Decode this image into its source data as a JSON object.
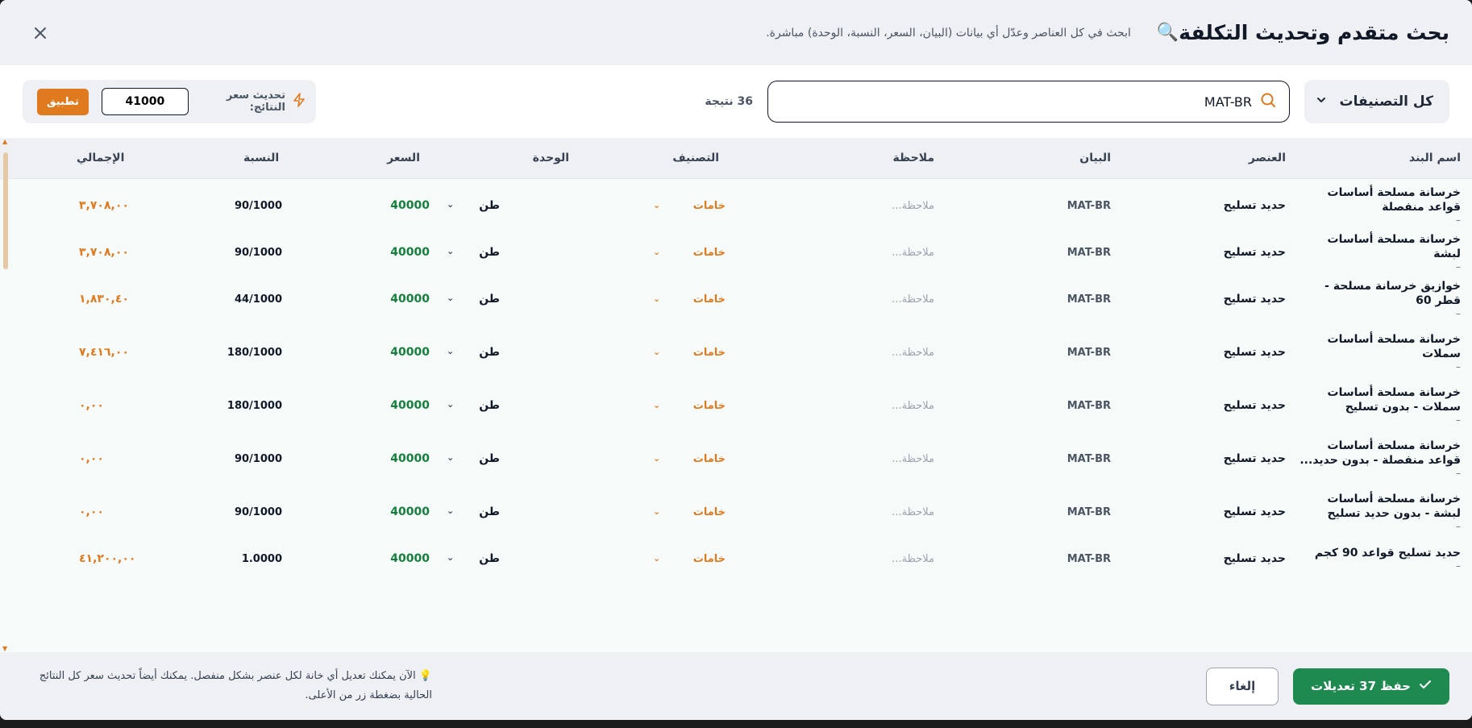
{
  "header": {
    "title": "بحث متقدم وتحديث التكلفة",
    "title_icon": "🔍",
    "subtitle": "ابحث في كل العناصر وعدّل أي بيانات (البيان، السعر، النسبة، الوحدة) مباشرة."
  },
  "toolbar": {
    "category_filter": "كل التصنيفات",
    "search_value": "MAT-BR",
    "result_count": "36 نتيجة",
    "bulk_label": "تحديث سعر النتائج:",
    "bulk_value": "41000",
    "apply_label": "تطبيق"
  },
  "columns": {
    "name": "اسم البند",
    "element": "العنصر",
    "description": "البيان",
    "note": "ملاحظة",
    "category": "التصنيف",
    "unit": "الوحدة",
    "price": "السعر",
    "ratio": "النسبة",
    "total": "الإجمالي"
  },
  "rows": [
    {
      "name": "خرسانة مسلحة أساسات قواعد منفصلة",
      "sub": "–",
      "element": "حديد تسليح",
      "description": "MAT-BR",
      "note": "ملاحظة...",
      "category": "خامات",
      "unit": "طن",
      "price": "40000",
      "ratio": "90/1000",
      "total": "٣,٧٠٨,٠٠"
    },
    {
      "name": "خرسانة مسلحة أساسات لبشة",
      "sub": "–",
      "element": "حديد تسليح",
      "description": "MAT-BR",
      "note": "ملاحظة...",
      "category": "خامات",
      "unit": "طن",
      "price": "40000",
      "ratio": "90/1000",
      "total": "٣,٧٠٨,٠٠"
    },
    {
      "name": "خوازيق خرسانة مسلحة - قطر 60",
      "sub": "–",
      "element": "حديد تسليح",
      "description": "MAT-BR",
      "note": "ملاحظة...",
      "category": "خامات",
      "unit": "طن",
      "price": "40000",
      "ratio": "44/1000",
      "total": "١,٨٣٠,٤٠"
    },
    {
      "name": "خرسانة مسلحة أساسات سملات",
      "sub": "–",
      "element": "حديد تسليح",
      "description": "MAT-BR",
      "note": "ملاحظة...",
      "category": "خامات",
      "unit": "طن",
      "price": "40000",
      "ratio": "180/1000",
      "total": "٧,٤١٦,٠٠"
    },
    {
      "name": "خرسانة مسلحة أساسات سملات - بدون تسليح",
      "sub": "–",
      "element": "حديد تسليح",
      "description": "MAT-BR",
      "note": "ملاحظة...",
      "category": "خامات",
      "unit": "طن",
      "price": "40000",
      "ratio": "180/1000",
      "total": "٠,٠٠"
    },
    {
      "name": "خرسانة مسلحة أساسات قواعد منفصلة - بدون حديد...",
      "sub": "–",
      "element": "حديد تسليح",
      "description": "MAT-BR",
      "note": "ملاحظة...",
      "category": "خامات",
      "unit": "طن",
      "price": "40000",
      "ratio": "90/1000",
      "total": "٠,٠٠"
    },
    {
      "name": "خرسانة مسلحة أساسات لبشة - بدون حديد تسليح",
      "sub": "–",
      "element": "حديد تسليح",
      "description": "MAT-BR",
      "note": "ملاحظة...",
      "category": "خامات",
      "unit": "طن",
      "price": "40000",
      "ratio": "90/1000",
      "total": "٠,٠٠"
    },
    {
      "name": "حديد تسليح قواعد 90 كجم",
      "sub": "–",
      "element": "حديد تسليح",
      "description": "MAT-BR",
      "note": "ملاحظة...",
      "category": "خامات",
      "unit": "طن",
      "price": "40000",
      "ratio": "1.0000",
      "total": "٤١,٢٠٠,٠٠"
    }
  ],
  "footer": {
    "save_label": "حفظ 37 تعديلات",
    "cancel_label": "إلغاء",
    "hint": "💡 الآن يمكنك تعديل أي خانة لكل عنصر بشكل منفصل. يمكنك أيضاً تحديث سعر كل النتائج الحالية بضغطة زر من الأعلى."
  },
  "colors": {
    "accent_orange": "#e07a1f",
    "price_green": "#15803d",
    "save_green": "#1e8a4f"
  }
}
